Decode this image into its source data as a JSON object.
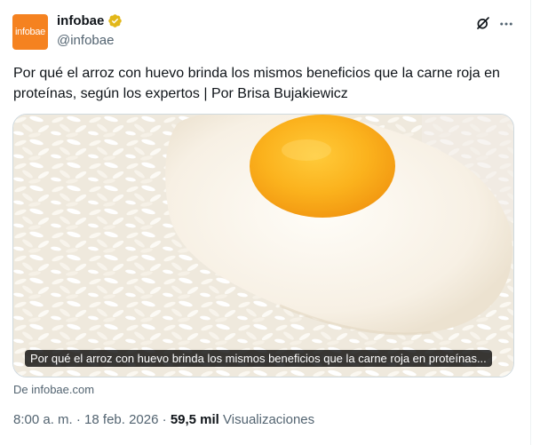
{
  "tweet": {
    "avatar_text": "infobae",
    "display_name": "infobae",
    "handle": "@infobae",
    "text": "Por qué el arroz con huevo brinda los mismos beneficios que la carne roja en proteínas, según los expertos | Por Brisa Bujakiewicz",
    "card_caption": "Por qué el arroz con huevo brinda los mismos beneficios que la carne roja en proteínas...",
    "source": "De infobae.com",
    "time": "8:00 a. m.",
    "separator": "·",
    "date": "18 feb. 2026",
    "views_count": "59,5 mil",
    "views_label": "Visualizaciones"
  },
  "colors": {
    "accent": "#f58220",
    "verified_badge": "#e2b719",
    "secondary_text": "#536471"
  },
  "icons": [
    "verified-badge-icon",
    "grok-icon",
    "more-icon"
  ]
}
